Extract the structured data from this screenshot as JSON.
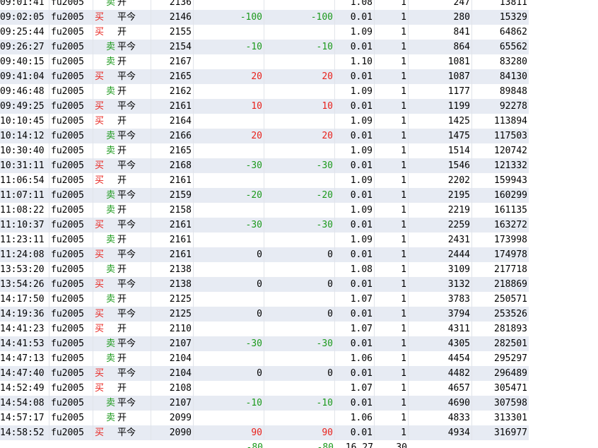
{
  "colors": {
    "buy": "#e8221c",
    "sell": "#1d9a1d",
    "alt_row": "#e7ebf3"
  },
  "rows": [
    {
      "time": "09:01:41",
      "symbol": "fu2005",
      "side": "卖",
      "action": "开",
      "price": "2136",
      "pl1": "",
      "pl2": "",
      "fee": "1.08",
      "vol": "1",
      "n1": "247",
      "n2": "13811"
    },
    {
      "time": "09:02:05",
      "symbol": "fu2005",
      "side": "买",
      "action": "平今",
      "price": "2146",
      "pl1": "-100",
      "pl2": "-100",
      "fee": "0.01",
      "vol": "1",
      "n1": "280",
      "n2": "15329"
    },
    {
      "time": "09:25:44",
      "symbol": "fu2005",
      "side": "买",
      "action": "开",
      "price": "2155",
      "pl1": "",
      "pl2": "",
      "fee": "1.09",
      "vol": "1",
      "n1": "841",
      "n2": "64862"
    },
    {
      "time": "09:26:27",
      "symbol": "fu2005",
      "side": "卖",
      "action": "平今",
      "price": "2154",
      "pl1": "-10",
      "pl2": "-10",
      "fee": "0.01",
      "vol": "1",
      "n1": "864",
      "n2": "65562"
    },
    {
      "time": "09:40:15",
      "symbol": "fu2005",
      "side": "卖",
      "action": "开",
      "price": "2167",
      "pl1": "",
      "pl2": "",
      "fee": "1.10",
      "vol": "1",
      "n1": "1081",
      "n2": "83280"
    },
    {
      "time": "09:41:04",
      "symbol": "fu2005",
      "side": "买",
      "action": "平今",
      "price": "2165",
      "pl1": "20",
      "pl2": "20",
      "fee": "0.01",
      "vol": "1",
      "n1": "1087",
      "n2": "84130"
    },
    {
      "time": "09:46:48",
      "symbol": "fu2005",
      "side": "卖",
      "action": "开",
      "price": "2162",
      "pl1": "",
      "pl2": "",
      "fee": "1.09",
      "vol": "1",
      "n1": "1177",
      "n2": "89848"
    },
    {
      "time": "09:49:25",
      "symbol": "fu2005",
      "side": "买",
      "action": "平今",
      "price": "2161",
      "pl1": "10",
      "pl2": "10",
      "fee": "0.01",
      "vol": "1",
      "n1": "1199",
      "n2": "92278"
    },
    {
      "time": "10:10:45",
      "symbol": "fu2005",
      "side": "买",
      "action": "开",
      "price": "2164",
      "pl1": "",
      "pl2": "",
      "fee": "1.09",
      "vol": "1",
      "n1": "1425",
      "n2": "113894"
    },
    {
      "time": "10:14:12",
      "symbol": "fu2005",
      "side": "卖",
      "action": "平今",
      "price": "2166",
      "pl1": "20",
      "pl2": "20",
      "fee": "0.01",
      "vol": "1",
      "n1": "1475",
      "n2": "117503"
    },
    {
      "time": "10:30:40",
      "symbol": "fu2005",
      "side": "卖",
      "action": "开",
      "price": "2165",
      "pl1": "",
      "pl2": "",
      "fee": "1.09",
      "vol": "1",
      "n1": "1514",
      "n2": "120742"
    },
    {
      "time": "10:31:11",
      "symbol": "fu2005",
      "side": "买",
      "action": "平今",
      "price": "2168",
      "pl1": "-30",
      "pl2": "-30",
      "fee": "0.01",
      "vol": "1",
      "n1": "1546",
      "n2": "121332"
    },
    {
      "time": "11:06:54",
      "symbol": "fu2005",
      "side": "买",
      "action": "开",
      "price": "2161",
      "pl1": "",
      "pl2": "",
      "fee": "1.09",
      "vol": "1",
      "n1": "2202",
      "n2": "159943"
    },
    {
      "time": "11:07:11",
      "symbol": "fu2005",
      "side": "卖",
      "action": "平今",
      "price": "2159",
      "pl1": "-20",
      "pl2": "-20",
      "fee": "0.01",
      "vol": "1",
      "n1": "2195",
      "n2": "160299"
    },
    {
      "time": "11:08:22",
      "symbol": "fu2005",
      "side": "卖",
      "action": "开",
      "price": "2158",
      "pl1": "",
      "pl2": "",
      "fee": "1.09",
      "vol": "1",
      "n1": "2219",
      "n2": "161135"
    },
    {
      "time": "11:10:37",
      "symbol": "fu2005",
      "side": "买",
      "action": "平今",
      "price": "2161",
      "pl1": "-30",
      "pl2": "-30",
      "fee": "0.01",
      "vol": "1",
      "n1": "2259",
      "n2": "163272"
    },
    {
      "time": "11:23:11",
      "symbol": "fu2005",
      "side": "卖",
      "action": "开",
      "price": "2161",
      "pl1": "",
      "pl2": "",
      "fee": "1.09",
      "vol": "1",
      "n1": "2431",
      "n2": "173998"
    },
    {
      "time": "11:24:08",
      "symbol": "fu2005",
      "side": "买",
      "action": "平今",
      "price": "2161",
      "pl1": "0",
      "pl2": "0",
      "fee": "0.01",
      "vol": "1",
      "n1": "2444",
      "n2": "174978"
    },
    {
      "time": "13:53:20",
      "symbol": "fu2005",
      "side": "卖",
      "action": "开",
      "price": "2138",
      "pl1": "",
      "pl2": "",
      "fee": "1.08",
      "vol": "1",
      "n1": "3109",
      "n2": "217718"
    },
    {
      "time": "13:54:26",
      "symbol": "fu2005",
      "side": "买",
      "action": "平今",
      "price": "2138",
      "pl1": "0",
      "pl2": "0",
      "fee": "0.01",
      "vol": "1",
      "n1": "3132",
      "n2": "218869"
    },
    {
      "time": "14:17:50",
      "symbol": "fu2005",
      "side": "卖",
      "action": "开",
      "price": "2125",
      "pl1": "",
      "pl2": "",
      "fee": "1.07",
      "vol": "1",
      "n1": "3783",
      "n2": "250571"
    },
    {
      "time": "14:19:36",
      "symbol": "fu2005",
      "side": "买",
      "action": "平今",
      "price": "2125",
      "pl1": "0",
      "pl2": "0",
      "fee": "0.01",
      "vol": "1",
      "n1": "3794",
      "n2": "253526"
    },
    {
      "time": "14:41:23",
      "symbol": "fu2005",
      "side": "买",
      "action": "开",
      "price": "2110",
      "pl1": "",
      "pl2": "",
      "fee": "1.07",
      "vol": "1",
      "n1": "4311",
      "n2": "281893"
    },
    {
      "time": "14:41:53",
      "symbol": "fu2005",
      "side": "卖",
      "action": "平今",
      "price": "2107",
      "pl1": "-30",
      "pl2": "-30",
      "fee": "0.01",
      "vol": "1",
      "n1": "4305",
      "n2": "282501"
    },
    {
      "time": "14:47:13",
      "symbol": "fu2005",
      "side": "卖",
      "action": "开",
      "price": "2104",
      "pl1": "",
      "pl2": "",
      "fee": "1.06",
      "vol": "1",
      "n1": "4454",
      "n2": "295297"
    },
    {
      "time": "14:47:40",
      "symbol": "fu2005",
      "side": "买",
      "action": "平今",
      "price": "2104",
      "pl1": "0",
      "pl2": "0",
      "fee": "0.01",
      "vol": "1",
      "n1": "4482",
      "n2": "296489"
    },
    {
      "time": "14:52:49",
      "symbol": "fu2005",
      "side": "买",
      "action": "开",
      "price": "2108",
      "pl1": "",
      "pl2": "",
      "fee": "1.07",
      "vol": "1",
      "n1": "4657",
      "n2": "305471"
    },
    {
      "time": "14:54:08",
      "symbol": "fu2005",
      "side": "卖",
      "action": "平今",
      "price": "2107",
      "pl1": "-10",
      "pl2": "-10",
      "fee": "0.01",
      "vol": "1",
      "n1": "4690",
      "n2": "307598"
    },
    {
      "time": "14:57:17",
      "symbol": "fu2005",
      "side": "卖",
      "action": "开",
      "price": "2099",
      "pl1": "",
      "pl2": "",
      "fee": "1.06",
      "vol": "1",
      "n1": "4833",
      "n2": "313301"
    },
    {
      "time": "14:58:52",
      "symbol": "fu2005",
      "side": "买",
      "action": "平今",
      "price": "2090",
      "pl1": "90",
      "pl2": "90",
      "fee": "0.01",
      "vol": "1",
      "n1": "4934",
      "n2": "316977"
    }
  ],
  "footer": {
    "pl1": "-80",
    "pl2": "-80",
    "fee": "16.27",
    "vol": "30"
  }
}
